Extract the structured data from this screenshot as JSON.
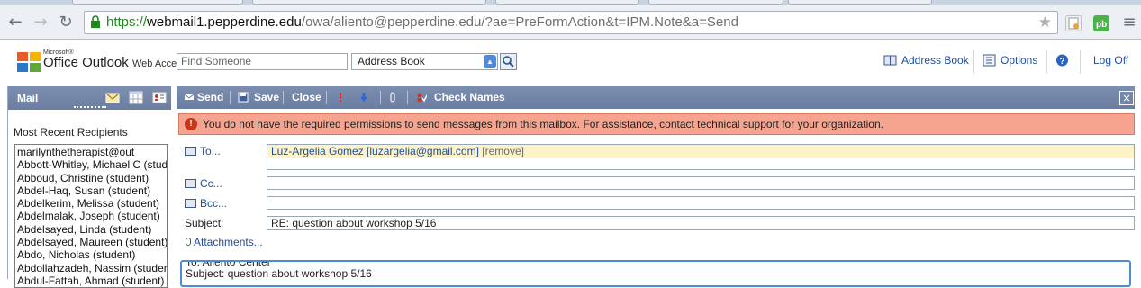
{
  "browser": {
    "url_scheme": "https://",
    "url_host": "webmail1.pepperdine.edu",
    "url_path": "/owa/aliento@pepperdine.edu/?ae=PreFormAction&t=IPM.Note&a=Send",
    "back_icon": "back-arrow-icon",
    "forward_icon": "forward-arrow-icon",
    "reload_icon": "reload-icon",
    "lock_icon": "lock-icon",
    "star_icon": "bookmark-star-icon",
    "menu_icon": "hamburger-menu-icon"
  },
  "header": {
    "brand_microsoft": "Microsoft®",
    "brand_name": "Office Outlook",
    "brand_sub": "Web Access",
    "find_placeholder": "Find Someone",
    "address_select": "Address Book",
    "links": {
      "address_book": "Address Book",
      "options": "Options",
      "log_off": "Log Off"
    }
  },
  "sidebar": {
    "title": "Mail",
    "recent_title": "Most Recent Recipients",
    "recipients": [
      "marilynthetherapist@out",
      "Abbott-Whitley, Michael C (stude...",
      "Abboud, Christine (student)",
      "Abdel-Haq, Susan (student)",
      "Abdelkerim, Melissa (student)",
      "Abdelmalak, Joseph (student)",
      "Abdelsayed, Linda (student)",
      "Abdelsayed, Maureen (student)",
      "Abdo, Nicholas (student)",
      "Abdollahzadeh, Nassim (student)",
      "Abdul-Fattah, Ahmad (student)"
    ]
  },
  "toolbar": {
    "send": "Send",
    "save": "Save",
    "close": "Close",
    "check_names": "Check Names"
  },
  "infobar": {
    "message": "You do not have the required permissions to send messages from this mailbox. For assistance, contact technical support for your organization."
  },
  "compose": {
    "to_label": "To...",
    "cc_label": "Cc...",
    "bcc_label": "Bcc...",
    "subject_label": "Subject:",
    "attachments_label": "Attachments...",
    "to_recipient": "Luz-Argelia Gomez [luzargelia@gmail.com]",
    "to_remove": "[remove]",
    "cc_value": "",
    "bcc_value": "",
    "subject_value": "RE: question about workshop 5/16",
    "body_line1": "To: Aliento Center",
    "body_line2": "Subject: question about workshop 5/16"
  },
  "colors": {
    "toolbar": "#7385a8",
    "infobar": "#f4a48f",
    "link": "#1f4ea3",
    "recipient_highlight": "#fdf3c6"
  }
}
